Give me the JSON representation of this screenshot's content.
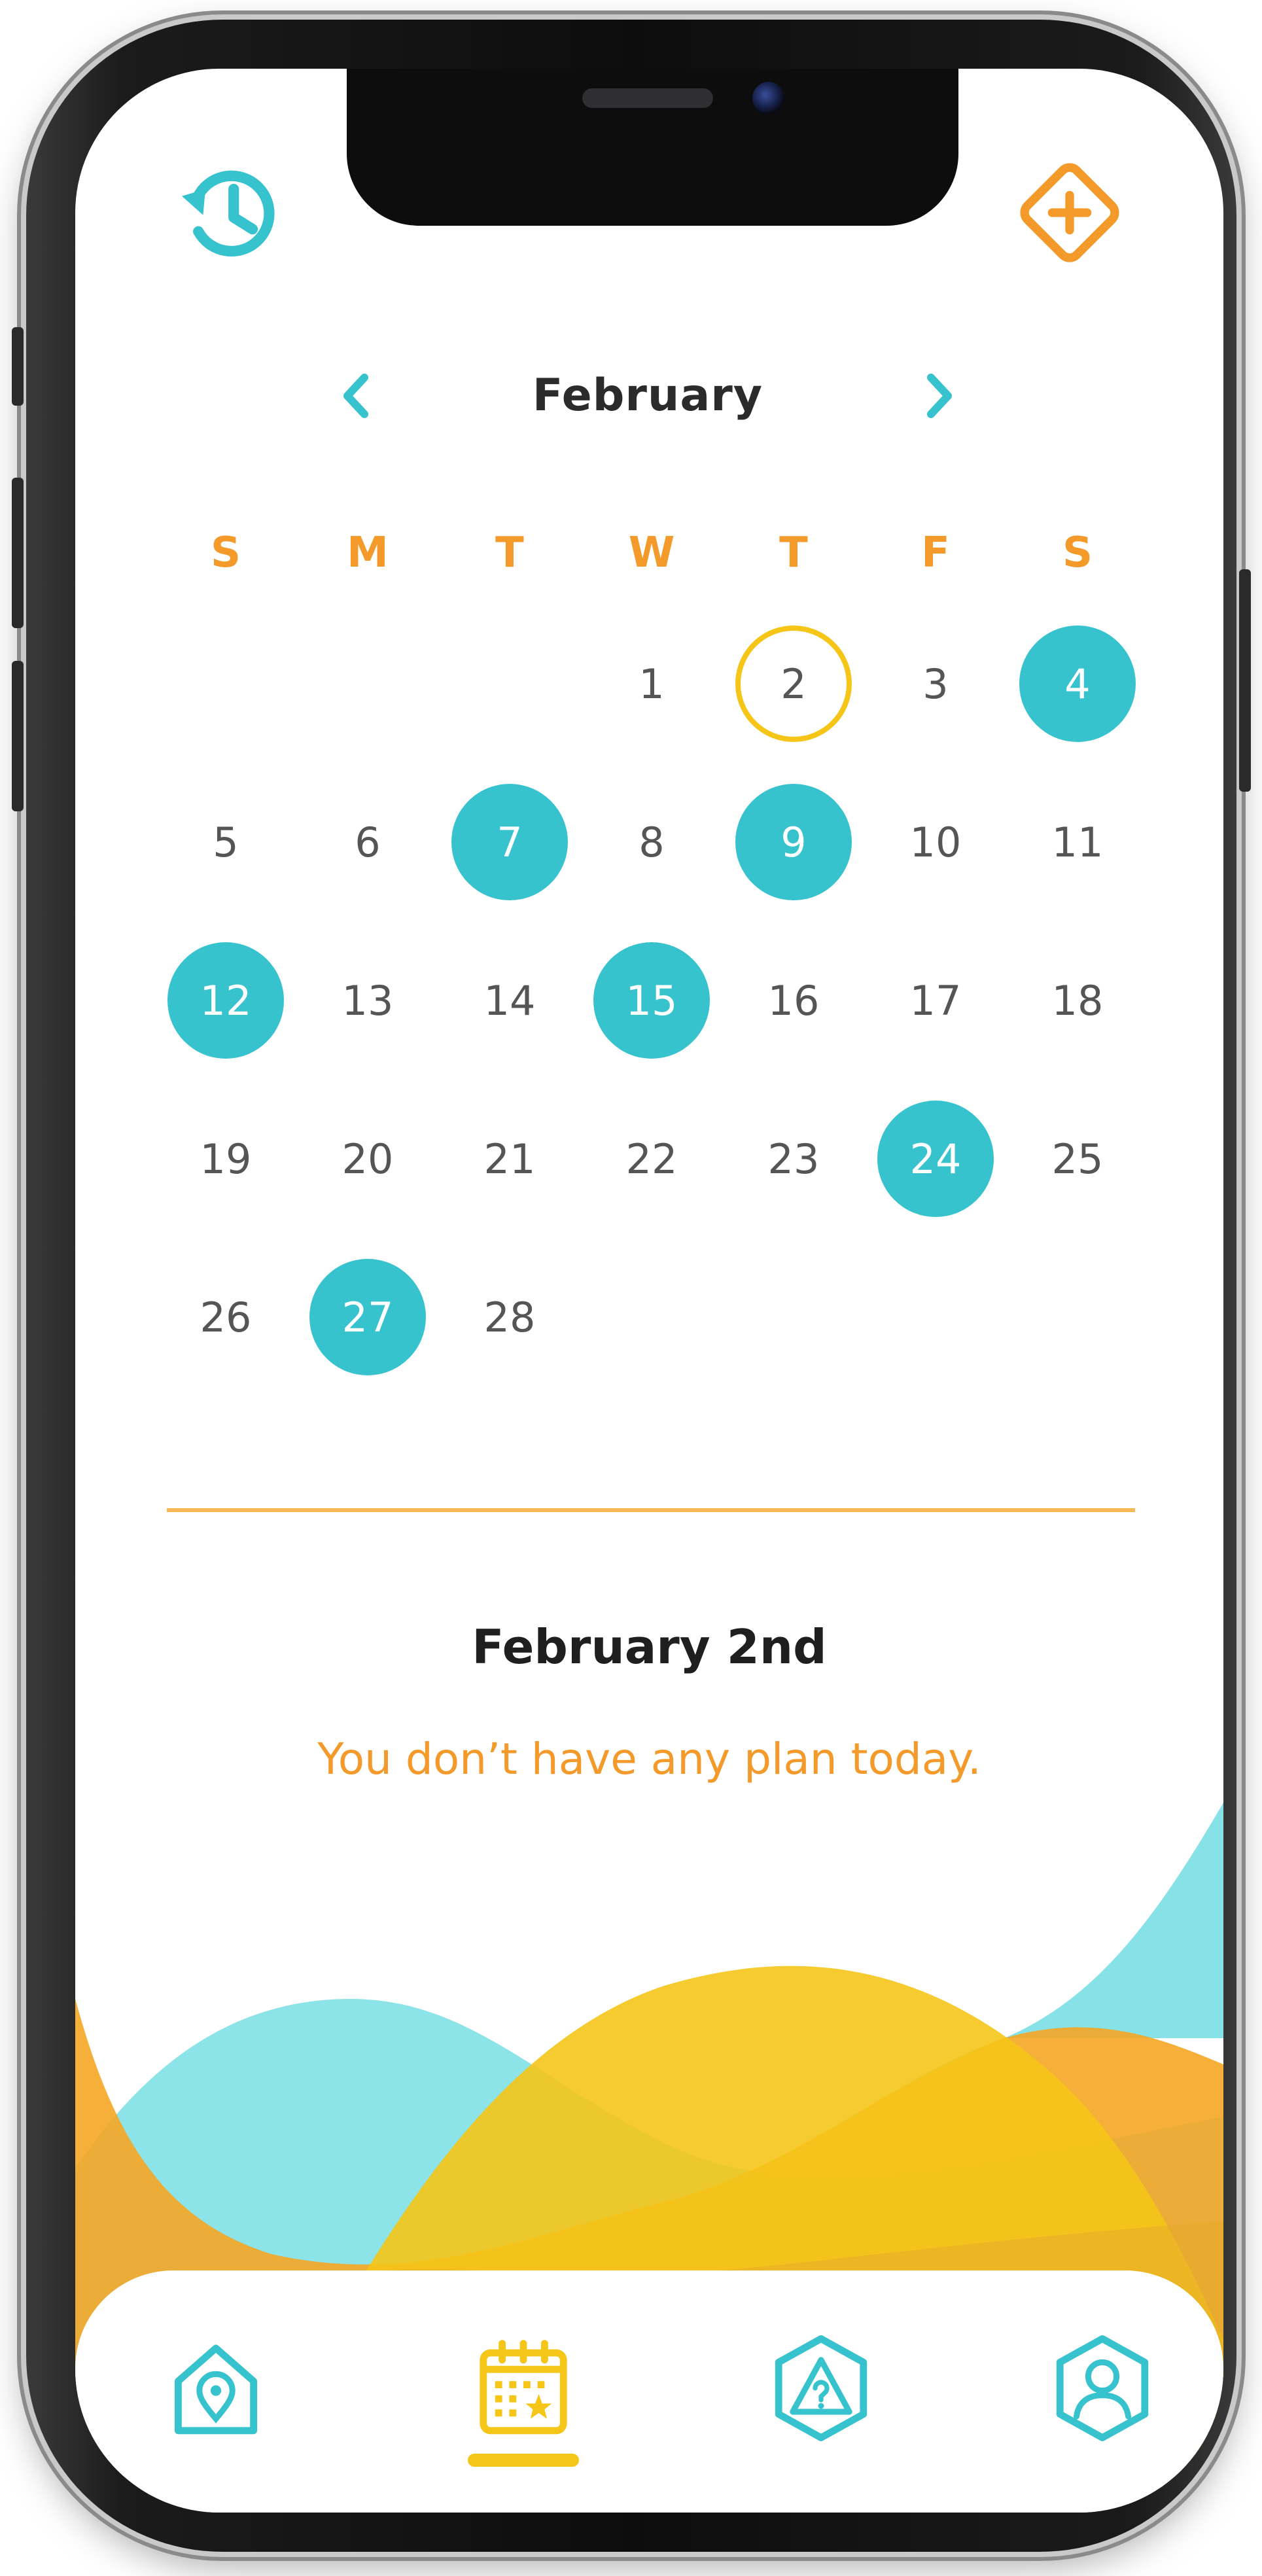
{
  "colors": {
    "teal": "#36c3cd",
    "orange": "#f39a2b",
    "yellow": "#f5c518",
    "text_dark": "#2b2b2b",
    "text_day": "#555555"
  },
  "header": {
    "left_icon": "history-icon",
    "right_icon": "add-diamond-icon"
  },
  "calendar": {
    "month": "February",
    "prev_icon": "chevron-left-icon",
    "next_icon": "chevron-right-icon",
    "weekdays": [
      "S",
      "M",
      "T",
      "W",
      "T",
      "F",
      "S"
    ],
    "weeks": [
      [
        {
          "day": "",
          "state": "empty"
        },
        {
          "day": "",
          "state": "empty"
        },
        {
          "day": "",
          "state": "empty"
        },
        {
          "day": "1",
          "state": "normal"
        },
        {
          "day": "2",
          "state": "today"
        },
        {
          "day": "3",
          "state": "normal"
        },
        {
          "day": "4",
          "state": "marked"
        }
      ],
      [
        {
          "day": "5",
          "state": "normal"
        },
        {
          "day": "6",
          "state": "normal"
        },
        {
          "day": "7",
          "state": "marked"
        },
        {
          "day": "8",
          "state": "normal"
        },
        {
          "day": "9",
          "state": "marked"
        },
        {
          "day": "10",
          "state": "normal"
        },
        {
          "day": "11",
          "state": "normal"
        }
      ],
      [
        {
          "day": "12",
          "state": "marked"
        },
        {
          "day": "13",
          "state": "normal"
        },
        {
          "day": "14",
          "state": "normal"
        },
        {
          "day": "15",
          "state": "marked"
        },
        {
          "day": "16",
          "state": "normal"
        },
        {
          "day": "17",
          "state": "normal"
        },
        {
          "day": "18",
          "state": "normal"
        }
      ],
      [
        {
          "day": "19",
          "state": "normal"
        },
        {
          "day": "20",
          "state": "normal"
        },
        {
          "day": "21",
          "state": "normal"
        },
        {
          "day": "22",
          "state": "normal"
        },
        {
          "day": "23",
          "state": "normal"
        },
        {
          "day": "24",
          "state": "marked"
        },
        {
          "day": "25",
          "state": "normal"
        }
      ],
      [
        {
          "day": "26",
          "state": "normal"
        },
        {
          "day": "27",
          "state": "marked"
        },
        {
          "day": "28",
          "state": "normal"
        },
        {
          "day": "",
          "state": "empty"
        },
        {
          "day": "",
          "state": "empty"
        },
        {
          "day": "",
          "state": "empty"
        },
        {
          "day": "",
          "state": "empty"
        }
      ]
    ]
  },
  "selected": {
    "date_label": "February 2nd",
    "message": "You don’t have any plan today."
  },
  "bottom_nav": {
    "items": [
      {
        "icon": "home-location-icon",
        "active": false
      },
      {
        "icon": "calendar-star-icon",
        "active": true
      },
      {
        "icon": "question-hexagon-icon",
        "active": false
      },
      {
        "icon": "profile-hexagon-icon",
        "active": false
      }
    ]
  }
}
